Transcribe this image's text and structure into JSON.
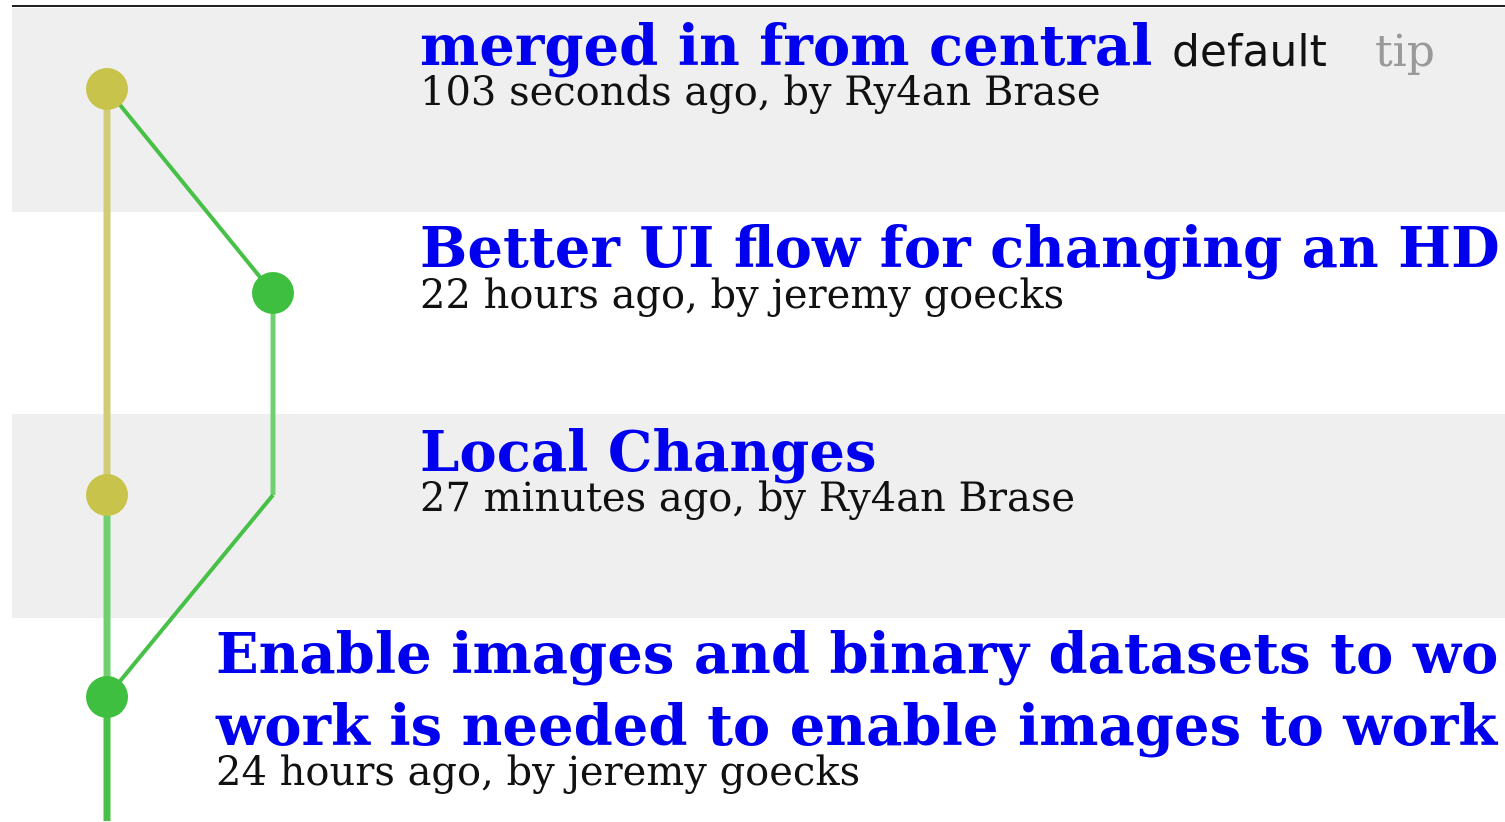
{
  "colors": {
    "branch_default": "#c8c34a",
    "branch_feature": "#3fbf3f",
    "link": "#0000ee",
    "row_shade": "#efefef",
    "tag_tip": "#999999"
  },
  "commits": [
    {
      "title": "merged in from central",
      "meta": "103 seconds ago, by Ry4an Brase",
      "branch_tag": "default",
      "tip_tag": "tip"
    },
    {
      "title": "Better UI flow for changing an HD",
      "meta": "22 hours ago, by jeremy goecks"
    },
    {
      "title": "Local Changes",
      "meta": "27 minutes ago, by Ry4an Brase"
    },
    {
      "title_line1": "Enable images and binary datasets to wo",
      "title_line2": "work is needed to enable images to work",
      "meta": "24 hours ago, by jeremy goecks"
    }
  ]
}
